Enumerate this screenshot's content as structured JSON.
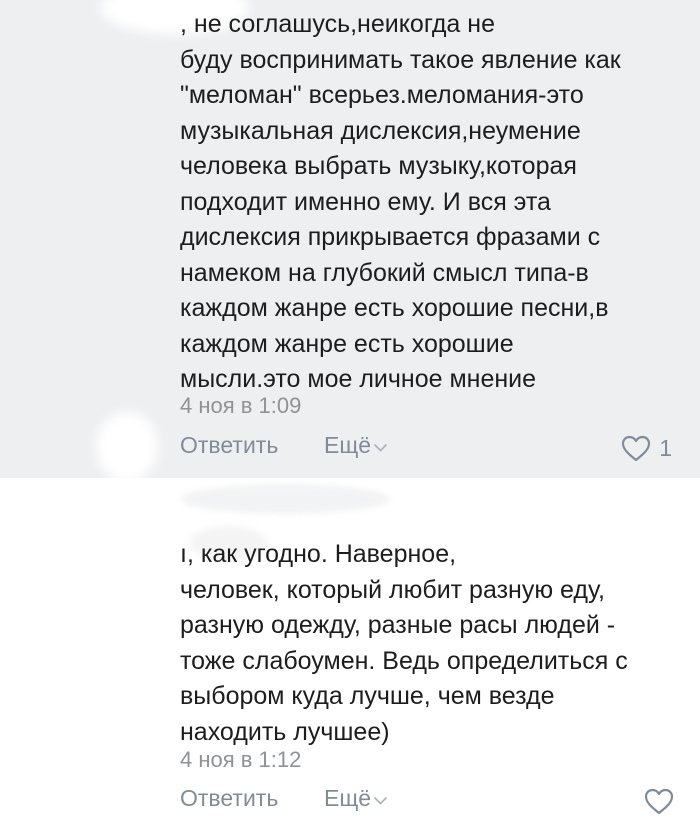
{
  "comments": [
    {
      "text": ", не соглашусь,неикогда не\nбуду воспринимать такое явление как\n\"меломан\" всерьез.меломания-это\nмузыкальная дислексия,неумение\nчеловека выбрать музыку,которая\nподходит именно ему. И вся эта\nдислексия прикрывается фразами с\nнамеком на глубокий смысл типа-в\nкаждом жанре есть хорошие песни,в\nкаждом жанре есть хорошие\nмысли.это мое личное мнение",
      "time": "4 ноя в 1:09",
      "reply_label": "Ответить",
      "more_label": "Ещё",
      "likes": "1",
      "like_icon": "heart-icon"
    },
    {
      "text": "ı, как угодно. Наверное,\nчеловек, который любит разную еду,\nразную одежду, разные расы людей -\nтоже слабоумен. Ведь определиться с\nвыбором куда лучше, чем везде\nнаходить лучшее)",
      "time": "4 ноя в 1:12",
      "reply_label": "Ответить",
      "more_label": "Ещё",
      "like_icon": "heart-icon"
    }
  ],
  "colors": {
    "first_comment_bg": "#eeeff1",
    "second_comment_bg": "#ffffff",
    "text": "#1d1d1d",
    "muted": "#818c99",
    "timestamp": "#8f9296"
  }
}
